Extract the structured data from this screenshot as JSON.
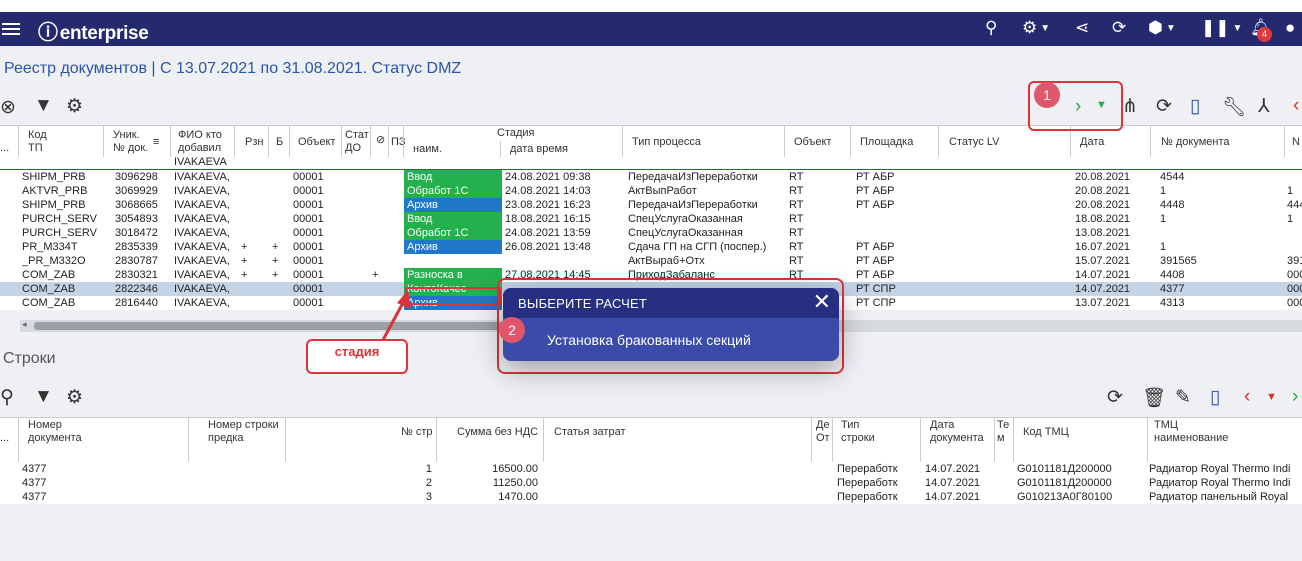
{
  "app": {
    "logo": "enterprise",
    "notifications": "4"
  },
  "icons": {
    "menu": "menu-icon",
    "search": "search-icon",
    "settings": "gear-icon",
    "share": "share-icon",
    "sync": "sync-icon",
    "box": "box-icon",
    "pause": "pause-icon",
    "bell": "bell-icon",
    "user": "user-icon"
  },
  "page": {
    "title": "Реестр документов | С 13.07.2021 по 31.08.2021. Статус DMZ"
  },
  "grid": {
    "headers": [
      {
        "l1": "Код",
        "l2": "ТП"
      },
      {
        "l1": "Уник.",
        "l2": "№ док."
      },
      {
        "l1": "ФИО кто",
        "l2": "добавил"
      },
      {
        "l1": "Рзн",
        "l2": ""
      },
      {
        "l1": "Б",
        "l2": ""
      },
      {
        "l1": "Объект",
        "l2": ""
      },
      {
        "l1": "Стат",
        "l2": "ДО"
      },
      {
        "l1": "",
        "l2": ""
      },
      {
        "l1": "ПЗ",
        "l2": ""
      },
      {
        "l1": "Стадия",
        "l2": ""
      },
      {
        "l1": "Тип процесса",
        "l2": ""
      },
      {
        "l1": "Объект",
        "l2": ""
      },
      {
        "l1": "Площадка",
        "l2": ""
      },
      {
        "l1": "Статус LV",
        "l2": ""
      },
      {
        "l1": "Дата",
        "l2": ""
      },
      {
        "l1": "№ документа",
        "l2": ""
      },
      {
        "l1": "N",
        "l2": ""
      }
    ],
    "stage_sub": {
      "name": "наим.",
      "datetime": "дата время"
    },
    "filter_value": "IVAKAEVA",
    "rows": [
      {
        "code": "SHIPM_PRB",
        "id": "3096298",
        "user": "IVAKAEVA,",
        "rzn": "",
        "b": "",
        "obj": "00001",
        "sdo": "",
        "pz": "",
        "stage": "Ввод",
        "stage_color": "#22b14c",
        "dt": "24.08.2021 09:38",
        "ptype": "ПередачаИзПереработки",
        "obj2": "RT",
        "site": "РТ АБР",
        "lv": "",
        "date": "20.08.2021",
        "doc": "4544",
        "n": ""
      },
      {
        "code": "AKTVR_PRB",
        "id": "3069929",
        "user": "IVAKAEVA,",
        "rzn": "",
        "b": "",
        "obj": "00001",
        "sdo": "",
        "pz": "",
        "stage": "Обработ 1С",
        "stage_color": "#22b14c",
        "dt": "24.08.2021 14:03",
        "ptype": "АктВыпРабот",
        "obj2": "RT",
        "site": "РТ АБР",
        "lv": "",
        "date": "20.08.2021",
        "doc": "1",
        "n": "1"
      },
      {
        "code": "SHIPM_PRB",
        "id": "3068665",
        "user": "IVAKAEVA,",
        "rzn": "",
        "b": "",
        "obj": "00001",
        "sdo": "",
        "pz": "",
        "stage": "Архив",
        "stage_color": "#1f78c8",
        "dt": "23.08.2021 16:23",
        "ptype": "ПередачаИзПереработки",
        "obj2": "RT",
        "site": "РТ АБР",
        "lv": "",
        "date": "20.08.2021",
        "doc": "4448",
        "n": "444"
      },
      {
        "code": "PURCH_SERV",
        "id": "3054893",
        "user": "IVAKAEVA,",
        "rzn": "",
        "b": "",
        "obj": "00001",
        "sdo": "",
        "pz": "",
        "stage": "Ввод",
        "stage_color": "#22b14c",
        "dt": "18.08.2021 16:15",
        "ptype": "СпецУслугаОказанная",
        "obj2": "RT",
        "site": "",
        "lv": "",
        "date": "18.08.2021",
        "doc": "1",
        "n": "1"
      },
      {
        "code": "PURCH_SERV",
        "id": "3018472",
        "user": "IVAKAEVA,",
        "rzn": "",
        "b": "",
        "obj": "00001",
        "sdo": "",
        "pz": "",
        "stage": "Обработ 1С",
        "stage_color": "#22b14c",
        "dt": "24.08.2021 13:59",
        "ptype": "СпецУслугаОказанная",
        "obj2": "RT",
        "site": "",
        "lv": "",
        "date": "13.08.2021",
        "doc": "",
        "n": ""
      },
      {
        "code": "PR_M334T",
        "id": "2835339",
        "user": "IVAKAEVA,",
        "rzn": "+",
        "b": "+",
        "obj": "00001",
        "sdo": "",
        "pz": "",
        "stage": "Архив",
        "stage_color": "#1f78c8",
        "dt": "26.08.2021 13:48",
        "ptype": "Сдача ГП на СГП (поспер.)",
        "obj2": "RT",
        "site": "РТ АБР",
        "lv": "",
        "date": "16.07.2021",
        "doc": "1",
        "n": ""
      },
      {
        "code": "_PR_M332O",
        "id": "2830787",
        "user": "IVAKAEVA,",
        "rzn": "+",
        "b": "+",
        "obj": "00001",
        "sdo": "",
        "pz": "",
        "stage": "",
        "stage_color": "",
        "dt": "",
        "ptype": "АктВыраб+Отх",
        "obj2": "RT",
        "site": "РТ АБР",
        "lv": "",
        "date": "15.07.2021",
        "doc": "391565",
        "n": "391"
      },
      {
        "code": "COM_ZAB",
        "id": "2830321",
        "user": "IVAKAEVA,",
        "rzn": "+",
        "b": "+",
        "obj": "00001",
        "sdo": "",
        "pz": "+",
        "stage": "Разноска в",
        "stage_color": "#22b14c",
        "dt": "27.08.2021 14:45",
        "ptype": "ПриходЗабаланс",
        "obj2": "RT",
        "site": "РТ АБР",
        "lv": "",
        "date": "14.07.2021",
        "doc": "4408",
        "n": "000"
      },
      {
        "code": "COM_ZAB",
        "id": "2822346",
        "user": "IVAKAEVA,",
        "rzn": "",
        "b": "",
        "obj": "00001",
        "sdo": "",
        "pz": "",
        "stage": "КонтоКачес",
        "stage_color": "#22b14c",
        "dt": "",
        "ptype": "",
        "obj2": "",
        "site": "РТ СПР",
        "lv": "",
        "date": "14.07.2021",
        "doc": "4377",
        "n": "000",
        "selected": true
      },
      {
        "code": "COM_ZAB",
        "id": "2816440",
        "user": "IVAKAEVA,",
        "rzn": "",
        "b": "",
        "obj": "00001",
        "sdo": "",
        "pz": "",
        "stage": "Архив",
        "stage_color": "#1f78c8",
        "dt": "",
        "ptype": "",
        "obj2": "",
        "site": "РТ СПР",
        "lv": "",
        "date": "13.07.2021",
        "doc": "4313",
        "n": "000"
      }
    ]
  },
  "lines": {
    "title": "Строки",
    "headers": [
      {
        "l1": "Номер",
        "l2": "документа"
      },
      {
        "l1": "Номер строки",
        "l2": "предка"
      },
      {
        "l1": "№ стр",
        "l2": ""
      },
      {
        "l1": "Сумма без НДС",
        "l2": ""
      },
      {
        "l1": "Статья затрат",
        "l2": ""
      },
      {
        "l1": "Де",
        "l2": "От"
      },
      {
        "l1": "Тип",
        "l2": "строки"
      },
      {
        "l1": "Дата",
        "l2": "документа"
      },
      {
        "l1": "Те",
        "l2": "м"
      },
      {
        "l1": "Код ТМЦ",
        "l2": ""
      },
      {
        "l1": "ТМЦ",
        "l2": "наименование"
      }
    ],
    "rows": [
      {
        "doc": "4377",
        "parent": "",
        "n": "1",
        "sum": "16500.00",
        "cost": "",
        "type": "Переработк",
        "date": "14.07.2021",
        "code": "G0101181Д200000",
        "name": "Радиатор Royal Thermo Indi"
      },
      {
        "doc": "4377",
        "parent": "",
        "n": "2",
        "sum": "11250.00",
        "cost": "",
        "type": "Переработк",
        "date": "14.07.2021",
        "code": "G0101181Д200000",
        "name": "Радиатор Royal Thermo Indi"
      },
      {
        "doc": "4377",
        "parent": "",
        "n": "3",
        "sum": "1470.00",
        "cost": "",
        "type": "Переработк",
        "date": "14.07.2021",
        "code": "G010213А0Г80100",
        "name": "Радиатор панельный Royal"
      }
    ]
  },
  "annotations": {
    "num1": "1",
    "num2": "2",
    "stage_label": "стадия"
  },
  "popup": {
    "title": "ВЫБЕРИТЕ РАСЧЕТ",
    "item": "Установка бракованных секций"
  }
}
